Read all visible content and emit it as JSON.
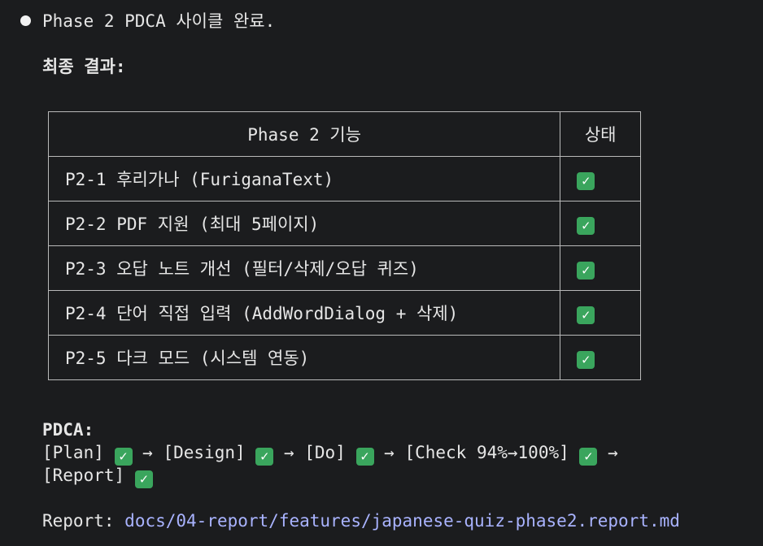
{
  "header": {
    "title": "Phase 2 PDCA 사이클 완료.",
    "subtitle": "최종 결과:"
  },
  "table": {
    "headers": [
      "Phase 2 기능",
      "상태"
    ],
    "rows": [
      {
        "feature": "P2-1 후리가나 (FuriganaText)",
        "status": "✓"
      },
      {
        "feature": "P2-2 PDF 지원 (최대 5페이지)",
        "status": "✓"
      },
      {
        "feature": "P2-3 오답 노트 개선 (필터/삭제/오답 퀴즈)",
        "status": "✓"
      },
      {
        "feature": "P2-4 단어 직접 입력 (AddWordDialog + 삭제)",
        "status": "✓"
      },
      {
        "feature": "P2-5 다크 모드 (시스템 연동)",
        "status": "✓"
      }
    ]
  },
  "pdca": {
    "label": "PDCA:",
    "steps": [
      {
        "label": "[Plan]",
        "status": "✓",
        "arrow": "→"
      },
      {
        "label": "[Design]",
        "status": "✓",
        "arrow": "→"
      },
      {
        "label": "[Do]",
        "status": "✓",
        "arrow": "→"
      },
      {
        "label": "[Check 94%→100%]",
        "status": "✓",
        "arrow": "→"
      },
      {
        "label": "[Report]",
        "status": "✓"
      }
    ]
  },
  "report": {
    "label": "Report:",
    "path": "docs/04-report/features/japanese-quiz-phase2.report.md"
  },
  "colors": {
    "background": "#1b1c1e",
    "text": "#e6e6e6",
    "link": "#a9b3ff",
    "check": "#3aa55d"
  }
}
